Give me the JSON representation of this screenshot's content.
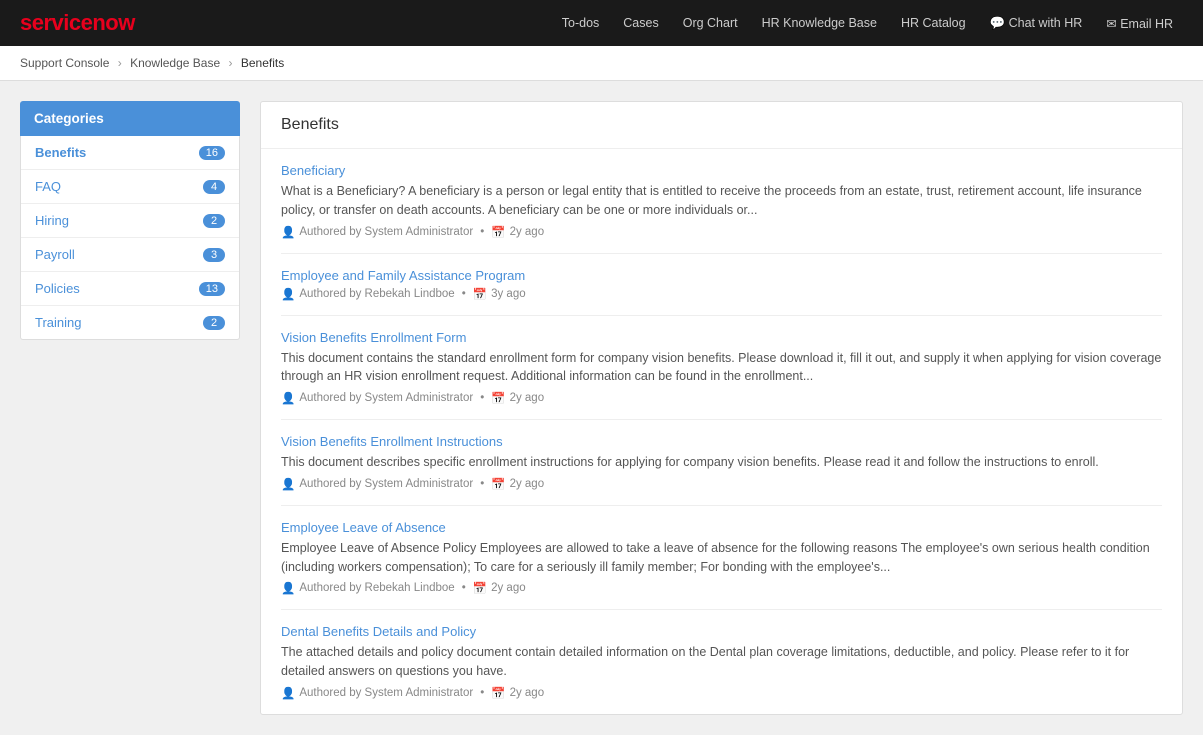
{
  "logo": {
    "prefix": "service",
    "suffix": "now"
  },
  "nav": {
    "links": [
      {
        "id": "todos",
        "label": "To-dos"
      },
      {
        "id": "cases",
        "label": "Cases"
      },
      {
        "id": "org-chart",
        "label": "Org Chart"
      },
      {
        "id": "hr-knowledge-base",
        "label": "HR Knowledge Base"
      },
      {
        "id": "hr-catalog",
        "label": "HR Catalog"
      },
      {
        "id": "chat-with-hr",
        "label": "💬 Chat with HR",
        "has-icon": true
      },
      {
        "id": "email-hr",
        "label": "✉ Email HR",
        "has-icon": true
      }
    ]
  },
  "breadcrumb": {
    "items": [
      {
        "label": "Support Console",
        "link": true
      },
      {
        "label": "Knowledge Base",
        "link": true
      },
      {
        "label": "Benefits",
        "link": false
      }
    ]
  },
  "sidebar": {
    "header": "Categories",
    "items": [
      {
        "label": "Benefits",
        "count": "16",
        "active": true
      },
      {
        "label": "FAQ",
        "count": "4",
        "active": false
      },
      {
        "label": "Hiring",
        "count": "2",
        "active": false
      },
      {
        "label": "Payroll",
        "count": "3",
        "active": false
      },
      {
        "label": "Policies",
        "count": "13",
        "active": false
      },
      {
        "label": "Training",
        "count": "2",
        "active": false
      }
    ]
  },
  "content": {
    "title": "Benefits",
    "articles": [
      {
        "id": "beneficiary",
        "title": "Beneficiary",
        "excerpt": "What is a Beneficiary? A beneficiary is a person or legal entity that is entitled to receive the proceeds from an estate, trust, retirement account, life insurance policy, or transfer on death accounts. A beneficiary can be one or more individuals or...",
        "author": "System Administrator",
        "age": "2y ago"
      },
      {
        "id": "employee-family-assistance",
        "title": "Employee and Family Assistance Program",
        "excerpt": "",
        "author": "Rebekah Lindboe",
        "age": "3y ago"
      },
      {
        "id": "vision-benefits-enrollment-form",
        "title": "Vision Benefits Enrollment Form",
        "excerpt": "This document contains the standard enrollment form for company vision benefits. Please download it, fill it out, and supply it when applying for vision coverage through an HR vision enrollment request. Additional information can be found in the enrollment...",
        "author": "System Administrator",
        "age": "2y ago"
      },
      {
        "id": "vision-benefits-enrollment-instructions",
        "title": "Vision Benefits Enrollment Instructions",
        "excerpt": "This document describes specific enrollment instructions for applying for company vision benefits. Please read it and follow the instructions to enroll.",
        "author": "System Administrator",
        "age": "2y ago"
      },
      {
        "id": "employee-leave-of-absence",
        "title": "Employee Leave of Absence",
        "excerpt": "Employee Leave of Absence Policy Employees are allowed to take a leave of absence for the following reasons The employee's own serious health condition (including workers compensation); To care for a seriously ill family member; For bonding with the employee's...",
        "author": "Rebekah Lindboe",
        "age": "2y ago"
      },
      {
        "id": "dental-benefits",
        "title": "Dental Benefits Details and Policy",
        "excerpt": "The attached details and policy document contain detailed information on the Dental plan coverage limitations, deductible, and policy. Please refer to it for detailed answers on questions you have.",
        "author": "System Administrator",
        "age": "2y ago"
      }
    ]
  }
}
